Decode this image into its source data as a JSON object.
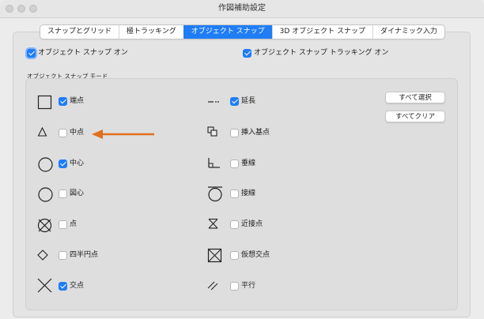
{
  "window": {
    "title": "作図補助設定"
  },
  "tabs": [
    {
      "label": "スナップとグリッド",
      "active": false
    },
    {
      "label": "極トラッキング",
      "active": false
    },
    {
      "label": "オブジェクト スナップ",
      "active": true
    },
    {
      "label": "3D オブジェクト スナップ",
      "active": false
    },
    {
      "label": "ダイナミック入力",
      "active": false
    }
  ],
  "options": {
    "osnap_on": {
      "label": "オブジェクト スナップ オン",
      "checked": true
    },
    "osnap_tracking_on": {
      "label": "オブジェクト スナップ トラッキング オン",
      "checked": true
    }
  },
  "modes": {
    "title": "オブジェクト スナップ モード",
    "left": [
      {
        "label": "端点",
        "icon": "endpoint-icon",
        "checked": true
      },
      {
        "label": "中点",
        "icon": "midpoint-icon",
        "checked": false
      },
      {
        "label": "中心",
        "icon": "center-icon",
        "checked": true
      },
      {
        "label": "図心",
        "icon": "centroid-icon",
        "checked": false
      },
      {
        "label": "点",
        "icon": "node-icon",
        "checked": false
      },
      {
        "label": "四半円点",
        "icon": "quadrant-icon",
        "checked": false
      },
      {
        "label": "交点",
        "icon": "intersection-icon",
        "checked": true
      }
    ],
    "right": [
      {
        "label": "延長",
        "icon": "extension-icon",
        "checked": true
      },
      {
        "label": "挿入基点",
        "icon": "insertion-icon",
        "checked": false
      },
      {
        "label": "垂線",
        "icon": "perpendicular-icon",
        "checked": false
      },
      {
        "label": "接線",
        "icon": "tangent-icon",
        "checked": false
      },
      {
        "label": "近接点",
        "icon": "nearest-icon",
        "checked": false
      },
      {
        "label": "仮想交点",
        "icon": "apparent-intersection-icon",
        "checked": false
      },
      {
        "label": "平行",
        "icon": "parallel-icon",
        "checked": false
      }
    ]
  },
  "buttons": {
    "select_all": "すべて選択",
    "clear_all": "すべてクリア"
  },
  "colors": {
    "accent": "#1f7df6",
    "arrow": "#e0701e"
  }
}
